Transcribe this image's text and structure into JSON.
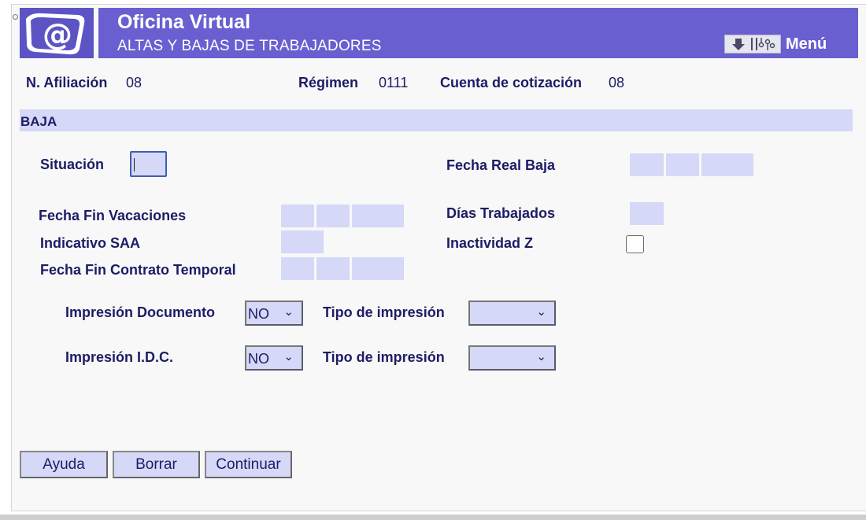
{
  "header": {
    "title": "Oficina Virtual",
    "subtitle": "ALTAS Y BAJAS DE TRABAJADORES",
    "menu_label": "Menú",
    "colors": {
      "banner": "#6a5fd0",
      "accent_light": "#d6d8f7",
      "text": "#1c1c66"
    }
  },
  "info": {
    "afiliacion_label": "N. Afiliación",
    "afiliacion_value": "08",
    "regimen_label": "Régimen",
    "regimen_value": "0111",
    "cuenta_label": "Cuenta de cotización",
    "cuenta_value": "08"
  },
  "section": {
    "title": "BAJA"
  },
  "form": {
    "situacion_label": "Situación",
    "fecha_real_baja_label": "Fecha Real Baja",
    "fecha_fin_vacaciones_label": "Fecha Fin Vacaciones",
    "dias_trabajados_label": "Días Trabajados",
    "indicativo_saa_label": "Indicativo SAA",
    "inactividad_z_label": "Inactividad Z",
    "fecha_fin_contrato_label": "Fecha Fin Contrato Temporal",
    "impresion_documento_label": "Impresión Documento",
    "impresion_documento_value": "NO",
    "tipo_impresion_label": "Tipo de impresión",
    "tipo_impresion_value": "",
    "impresion_idc_label": "Impresión I.D.C.",
    "impresion_idc_value": "NO",
    "tipo_impresion2_label": "Tipo de impresión",
    "tipo_impresion2_value": ""
  },
  "buttons": {
    "ayuda": "Ayuda",
    "borrar": "Borrar",
    "continuar": "Continuar"
  }
}
